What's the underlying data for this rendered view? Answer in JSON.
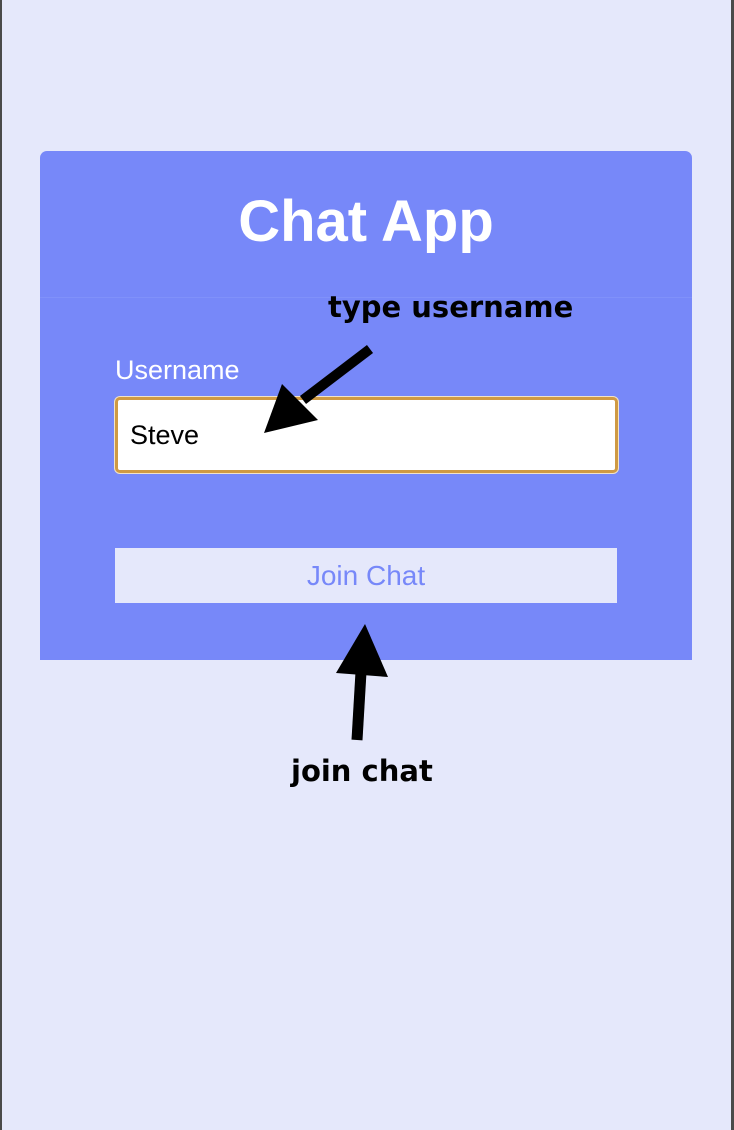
{
  "app": {
    "title": "Chat App"
  },
  "form": {
    "username_label": "Username",
    "username_value": "Steve",
    "join_button_label": "Join Chat"
  },
  "annotations": {
    "type_username": "type username",
    "join_chat": "join chat"
  },
  "colors": {
    "page_background": "#e5e8fb",
    "card_background": "#7788f9",
    "input_border_focus": "#cf9a44",
    "button_background": "#e5e8fb",
    "button_text": "#7788f9",
    "annotation_text": "#000000"
  },
  "icons": {
    "arrow_to_input": "arrow-icon",
    "arrow_to_button": "arrow-icon"
  }
}
